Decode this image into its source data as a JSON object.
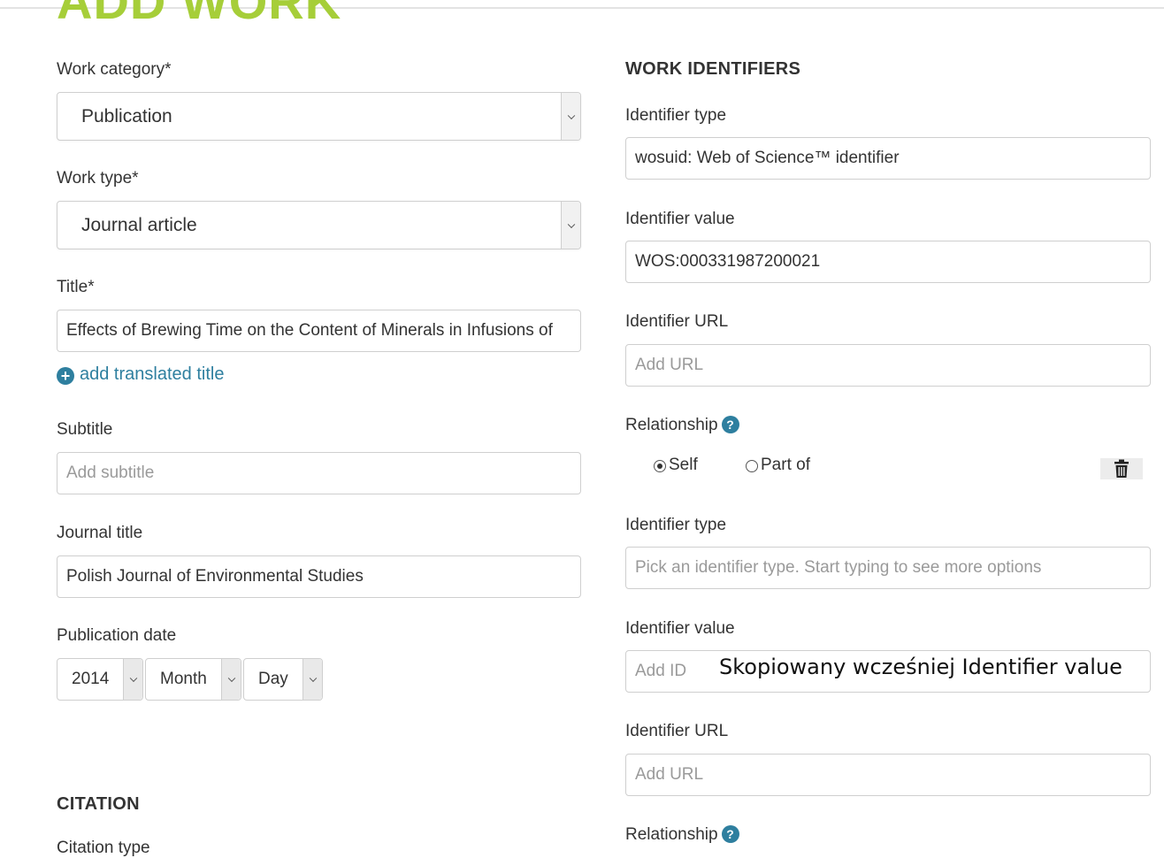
{
  "page": {
    "title": "ADD WORK",
    "accent_color": "#a6ce39",
    "link_color": "#2e7f9f"
  },
  "left": {
    "work_category": {
      "label": "Work category*",
      "value": "Publication"
    },
    "work_type": {
      "label": "Work type*",
      "value": "Journal article"
    },
    "title": {
      "label": "Title*",
      "value": "Effects of Brewing Time on the Content of Minerals in Infusions of "
    },
    "add_translated_title": "add translated title",
    "subtitle": {
      "label": "Subtitle",
      "placeholder": "Add subtitle"
    },
    "journal_title": {
      "label": "Journal title",
      "value": "Polish Journal of Environmental Studies"
    },
    "publication_date": {
      "label": "Publication date",
      "year": "2014",
      "month": "Month",
      "day": "Day"
    },
    "citation_section": "CITATION",
    "citation_type_label": "Citation type"
  },
  "right": {
    "section_title": "WORK IDENTIFIERS",
    "identifiers": [
      {
        "type_label": "Identifier type",
        "type_value": "wosuid: Web of Science™ identifier",
        "value_label": "Identifier value",
        "value": "WOS:000331987200021",
        "url_label": "Identifier URL",
        "url_placeholder": "Add URL",
        "relationship_label": "Relationship",
        "rel_self": "Self",
        "rel_part_of": "Part of",
        "selected": "Self"
      },
      {
        "type_label": "Identifier type",
        "type_placeholder": "Pick an identifier type. Start typing to see more options",
        "value_label": "Identifier value",
        "value_placeholder": "Add ID",
        "url_label": "Identifier URL",
        "url_placeholder": "Add URL",
        "relationship_label": "Relationship"
      }
    ]
  },
  "annotation": "Skopiowany wcześniej Identifier value",
  "icons": {
    "add": "plus-circle-icon",
    "help": "question-circle-icon",
    "delete": "trash-icon",
    "dropdown": "chevron-down-icon"
  }
}
